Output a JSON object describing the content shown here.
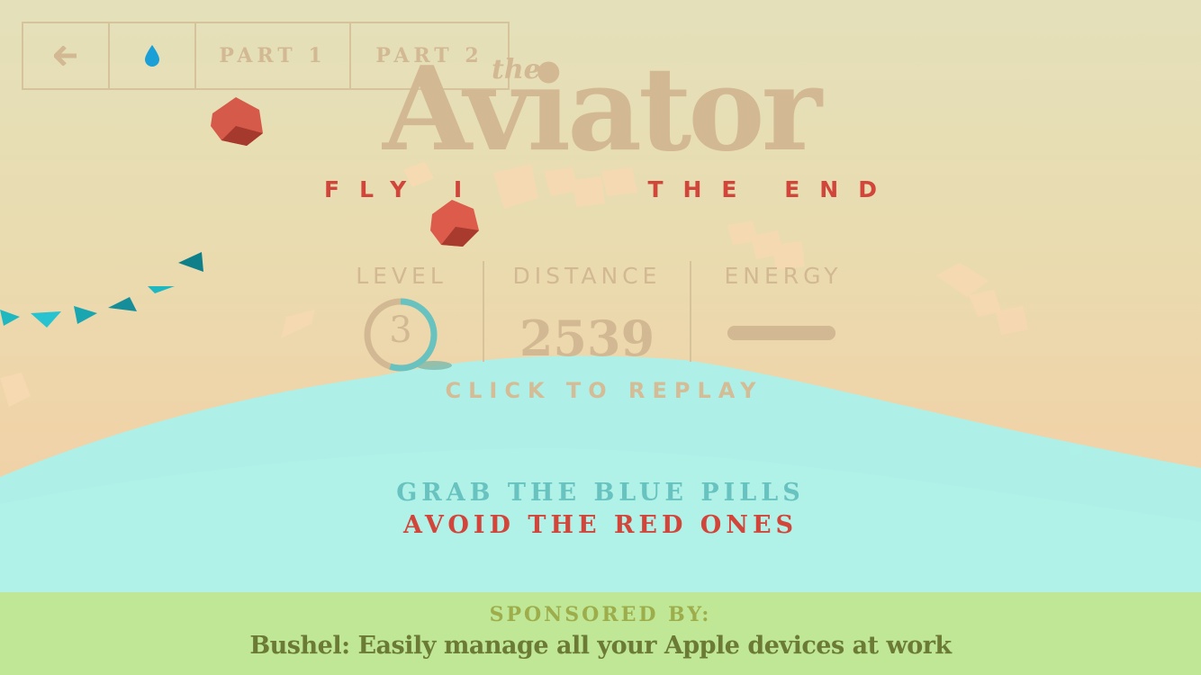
{
  "nav": {
    "back_icon": "arrow-left-icon",
    "drop_icon": "water-drop-icon",
    "part1_label": "PART 1",
    "part2_label": "PART 2"
  },
  "title": {
    "the": "the",
    "main": "Aviator",
    "subtitle": "FLY I      THE END"
  },
  "stats": {
    "level_label": "LEVEL",
    "level_value": "3",
    "level_progress": 0.55,
    "distance_label": "DISTANCE",
    "distance_value": "2539",
    "energy_label": "ENERGY",
    "energy_level": 1.0
  },
  "replay_label": "CLICK TO REPLAY",
  "instructions": {
    "line1": "GRAB THE BLUE PILLS",
    "line2": "AVOID THE RED ONES"
  },
  "sponsor": {
    "label": "SPONSORED BY:",
    "text": "Bushel: Easily manage all your Apple devices at work"
  },
  "colors": {
    "sky_top": "#e4e0ba",
    "sea": "#9ef2ee",
    "title": "#d2b893",
    "accent_red": "#d1453b",
    "accent_blue": "#68c3c0",
    "sponsor_bg": "#bfe795"
  }
}
